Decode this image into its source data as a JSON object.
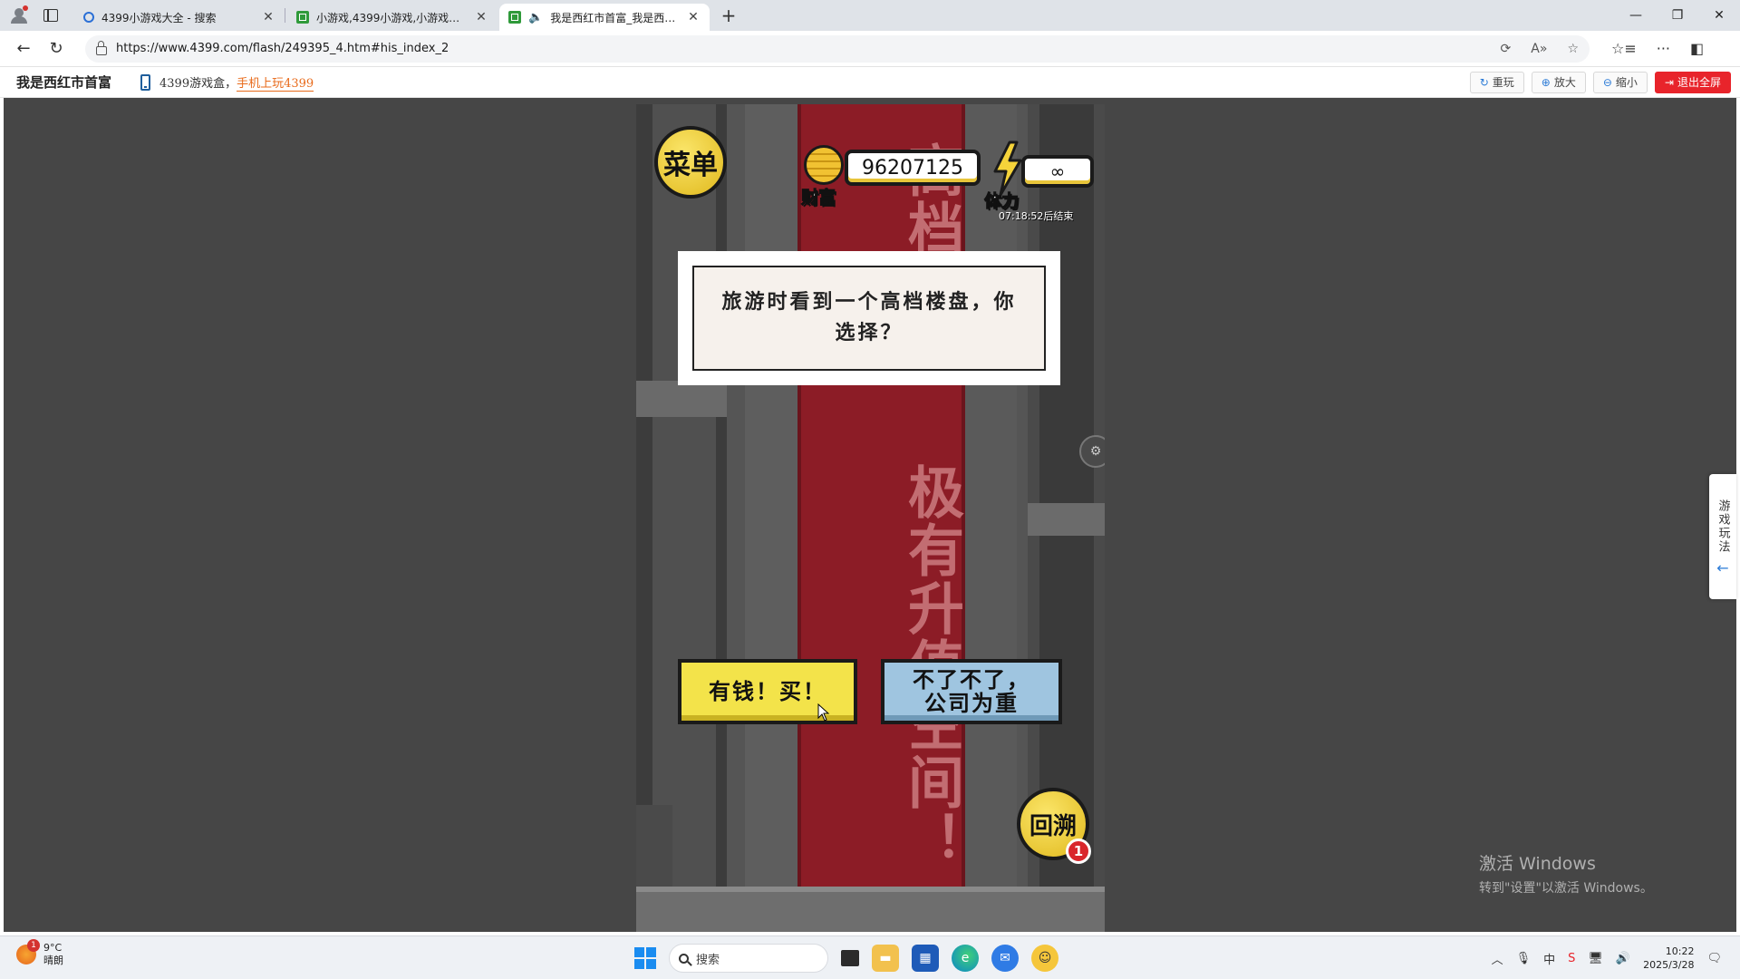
{
  "browser": {
    "tabs": [
      {
        "title": "4399小游戏大全 - 搜索",
        "icon": "search-favicon"
      },
      {
        "title": "小游戏,4399小游戏,小游戏大全,双",
        "icon": "4399-favicon"
      },
      {
        "title": "我是西红市首富_我是西红市",
        "icon": "4399-favicon",
        "active": true
      }
    ],
    "url": "https://www.4399.com/flash/249395_4.htm#his_index_2"
  },
  "page_header": {
    "game_title": "我是西红市首富",
    "promo_text": "4399游戏盒，",
    "promo_link": "手机上玩4399",
    "actions": {
      "replay": "重玩",
      "zoom_in": "放大",
      "zoom_out": "缩小",
      "exit_fullscreen": "退出全屏"
    }
  },
  "game": {
    "menu_label": "菜单",
    "wealth_value": "96207125",
    "wealth_label": "财富",
    "energy_value": "∞",
    "energy_label": "体力",
    "energy_timer": "07:18:52后结束",
    "banner_top": "高档",
    "banner_main": "极有升值空间！",
    "question": "旅游时看到一个高档楼盘，你选择？",
    "choice_buy": "有钱！买！",
    "choice_skip_line1": "不了不了，",
    "choice_skip_line2": "公司为重",
    "rewind_label": "回溯",
    "rewind_badge": "1",
    "colors": {
      "banner": "#8c1c26",
      "buy_button": "#f3e34a",
      "skip_button": "#9fc5e0",
      "gold": "#f1c232"
    }
  },
  "side_help": {
    "label": "游戏玩法",
    "arrow": "←"
  },
  "watermark": {
    "line1": "激活 Windows",
    "line2": "转到\"设置\"以激活 Windows。"
  },
  "taskbar": {
    "weather_temp": "9°C",
    "weather_desc": "晴朗",
    "weather_badge": "1",
    "search_placeholder": "搜索",
    "time": "10:22",
    "date": "2025/3/28"
  }
}
